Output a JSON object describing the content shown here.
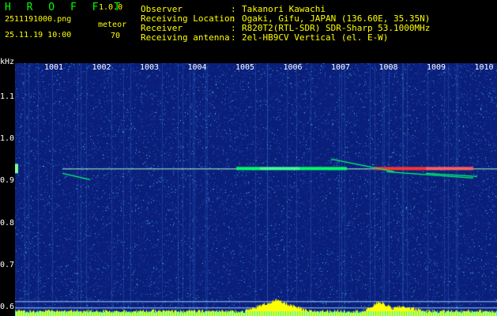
{
  "header": {
    "brand": "H R O F F T",
    "version": "1.0.0",
    "filename": "2511191000.png",
    "datetime": "25.11.19 10:00",
    "meteor_label": "meteor",
    "meteor_count": "70",
    "fields": [
      {
        "key": "Observer",
        "value": "Takanori Kawachi"
      },
      {
        "key": "Receiving Location",
        "value": "Ogaki, Gifu, JAPAN (136.60E, 35.35N)"
      },
      {
        "key": "Receiver",
        "value": "R820T2(RTL-SDR) SDR-Sharp 53.1000MHz"
      },
      {
        "key": "Receiving antenna",
        "value": "2el-HB9CV Vertical (el. E-W)"
      }
    ]
  },
  "chart_data": {
    "type": "heatmap",
    "ylabel": "kHz",
    "x_ticks": [
      "1001",
      "1002",
      "1003",
      "1004",
      "1005",
      "1006",
      "1007",
      "1008",
      "1009",
      "1010"
    ],
    "y_ticks": [
      "1.1",
      "1.0",
      "0.9",
      "0.8",
      "0.7",
      "0.6"
    ],
    "ylim": [
      0.58,
      1.18
    ],
    "carrier_khz": 0.93,
    "colors": {
      "background": "#0a1f7a",
      "noise": "#2a5fd0",
      "signal": "#00ff66",
      "peak": "#ff3333",
      "level": "#ffff00",
      "baseline": "#00ffff"
    }
  }
}
